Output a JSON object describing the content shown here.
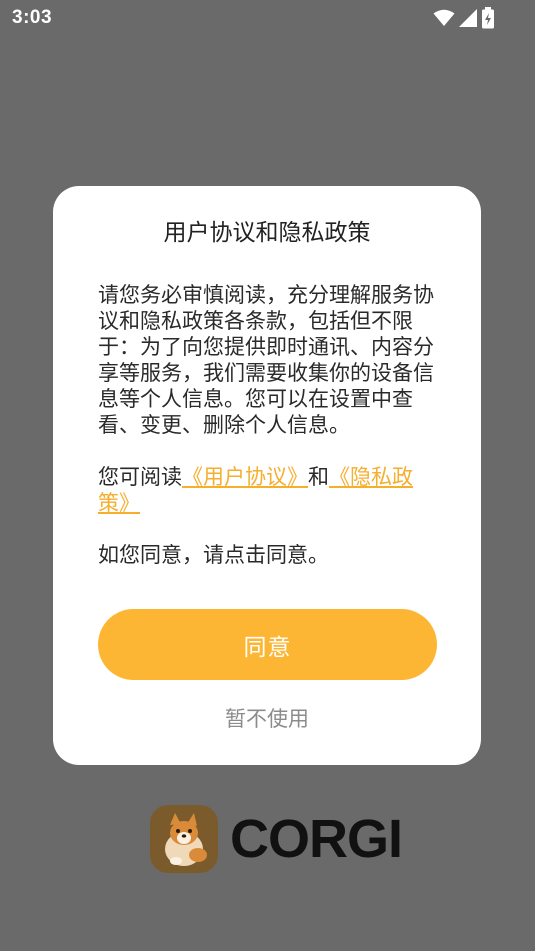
{
  "status_bar": {
    "time": "3:03",
    "icons": [
      "wifi-icon",
      "cellular-signal-icon",
      "battery-charging-icon"
    ]
  },
  "dialog": {
    "title": "用户协议和隐私政策",
    "paragraph1": "请您务必审慎阅读，充分理解服务协议和隐私政策各条款，包括但不限于：为了向您提供即时通讯、内容分享等服务，我们需要收集你的设备信息等个人信息。您可以在设置中查看、变更、删除个人信息。",
    "paragraph2": {
      "prefix": "您可阅读",
      "user_agreement_link": "《用户协议》",
      "conjunction": "和",
      "privacy_policy_link": "《隐私政策》"
    },
    "paragraph3": "如您同意，请点击同意。",
    "agree_label": "同意",
    "decline_label": "暂不使用"
  },
  "brand": {
    "name": "CORGI",
    "logo_icon": "corgi-dog-icon"
  },
  "colors": {
    "accent": "#fdb633",
    "link": "#f6ae2d",
    "backdrop": "#6a6a6a",
    "logo_bg": "#7b5a2c"
  }
}
